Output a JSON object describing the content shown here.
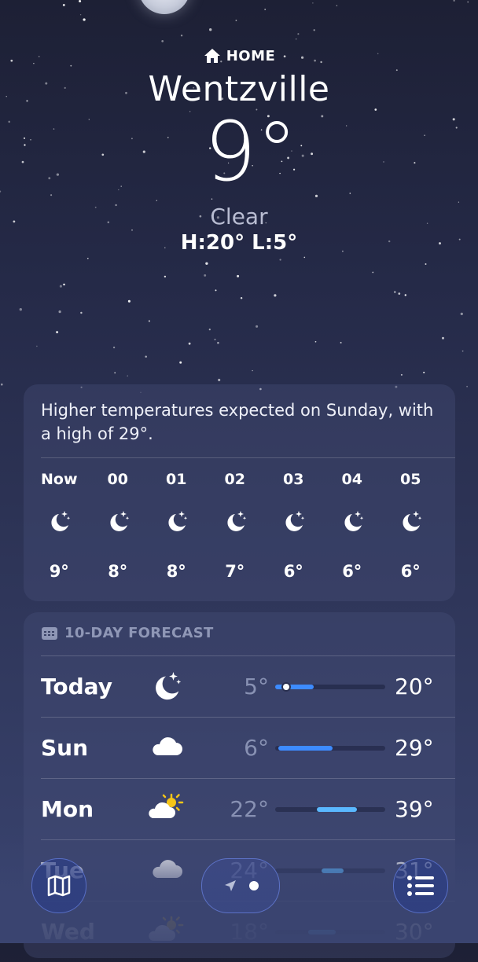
{
  "header": {
    "home_label": "HOME",
    "city": "Wentzville",
    "temperature": "9°",
    "condition": "Clear",
    "high_low": "H:20°  L:5°"
  },
  "summary": {
    "text": "Higher temperatures expected on Sunday, with a high of 29°."
  },
  "hourly": [
    {
      "time": "Now",
      "icon": "moon-stars-icon",
      "temp": "9°"
    },
    {
      "time": "00",
      "icon": "moon-stars-icon",
      "temp": "8°"
    },
    {
      "time": "01",
      "icon": "moon-stars-icon",
      "temp": "8°"
    },
    {
      "time": "02",
      "icon": "moon-stars-icon",
      "temp": "7°"
    },
    {
      "time": "03",
      "icon": "moon-stars-icon",
      "temp": "6°"
    },
    {
      "time": "04",
      "icon": "moon-stars-icon",
      "temp": "6°"
    },
    {
      "time": "05",
      "icon": "moon-stars-icon",
      "temp": "6°"
    }
  ],
  "forecast": {
    "title": "10-DAY FORECAST",
    "days": [
      {
        "day": "Today",
        "icon": "moon-stars-icon",
        "low": "5°",
        "high": "20°",
        "range_start": 0.0,
        "range_end": 0.35,
        "current": 0.1,
        "color": "#3d8bff"
      },
      {
        "day": "Sun",
        "icon": "cloud-icon",
        "low": "6°",
        "high": "29°",
        "range_start": 0.03,
        "range_end": 0.52,
        "color": "#3d8bff"
      },
      {
        "day": "Mon",
        "icon": "partly-sunny-icon",
        "low": "22°",
        "high": "39°",
        "range_start": 0.38,
        "range_end": 0.74,
        "color": "#5ab8ff"
      },
      {
        "day": "Tue",
        "icon": "cloud-icon",
        "low": "24°",
        "high": "31°",
        "range_start": 0.42,
        "range_end": 0.62,
        "color": "#5ab8ff"
      },
      {
        "day": "Wed",
        "icon": "partly-sunny-icon",
        "low": "18°",
        "high": "30°",
        "range_start": 0.3,
        "range_end": 0.55,
        "color": "#5ab8ff"
      }
    ]
  },
  "toolbar": {
    "map_icon": "map-icon",
    "location_icon": "location-arrow-icon",
    "list_icon": "list-icon"
  }
}
